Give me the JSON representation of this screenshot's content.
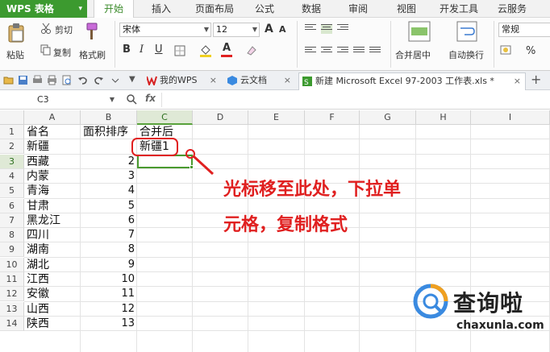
{
  "app": {
    "name": "WPS 表格",
    "caret": "▾"
  },
  "menu": [
    "开始",
    "插入",
    "页面布局",
    "公式",
    "数据",
    "审阅",
    "视图",
    "开发工具",
    "云服务"
  ],
  "ribbon": {
    "paste": "粘贴",
    "cut": "剪切",
    "copy": "复制",
    "format_painter": "格式刷",
    "font_name": "宋体",
    "font_size": "12",
    "merge_center": "合并居中",
    "wrap_text": "自动换行",
    "number_format": "常规",
    "percent": "%",
    "bold": "B",
    "italic": "I",
    "underline": "U",
    "font_color_letter": "A",
    "grow_letter": "A",
    "shrink_letter": "A"
  },
  "doc_tabs": [
    {
      "label": "我的WPS",
      "close": "×"
    },
    {
      "label": "云文档",
      "close": "×"
    },
    {
      "label": "新建 Microsoft Excel 97-2003 工作表.xls *",
      "close": "×"
    }
  ],
  "tab_add": "+",
  "formula_bar": {
    "cell_ref": "C3",
    "fx": "fx",
    "value": ""
  },
  "columns": [
    "A",
    "B",
    "C",
    "D",
    "E",
    "F",
    "G",
    "H",
    "I"
  ],
  "rows": [
    "1",
    "2",
    "3",
    "4",
    "5",
    "6",
    "7",
    "8",
    "9",
    "10",
    "11",
    "12",
    "13",
    "14"
  ],
  "cells": {
    "A": [
      "省名",
      "新疆",
      "西藏",
      "内蒙",
      "青海",
      "甘肃",
      "黑龙江",
      "四川",
      "湖南",
      "湖北",
      "江西",
      "安徽",
      "山西",
      "陕西"
    ],
    "B": [
      "面积排序",
      "",
      "2",
      "3",
      "4",
      "5",
      "6",
      "7",
      "8",
      "9",
      "10",
      "11",
      "12",
      "13"
    ],
    "C": [
      "合并后",
      "新疆1",
      "",
      "",
      "",
      "",
      "",
      "",
      "",
      "",
      "",
      "",
      "",
      ""
    ]
  },
  "annotation": {
    "line1": "光标移至此处，下拉单",
    "line2": "元格，复制格式"
  },
  "watermark": {
    "title": "查询啦",
    "url": "chaxunla.com"
  },
  "colors": {
    "accent": "#3c9a2f",
    "annotation": "#e02020",
    "selection": "#4a9a2f"
  }
}
